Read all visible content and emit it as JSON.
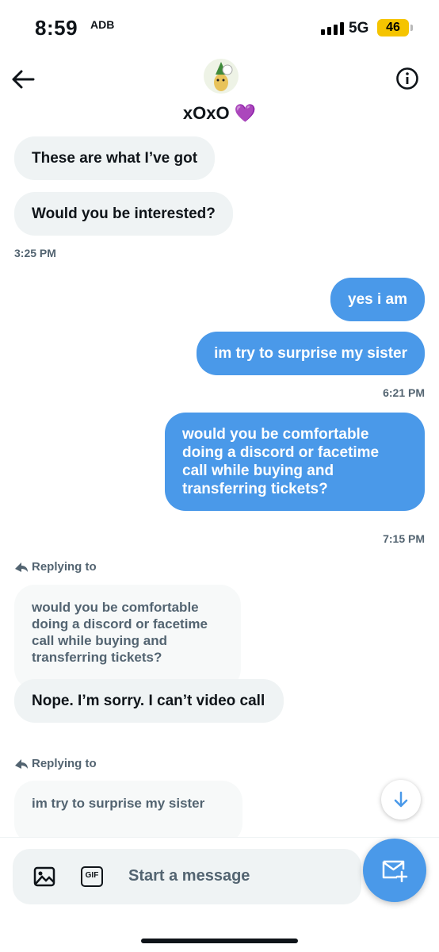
{
  "status_bar": {
    "time": "8:59",
    "extra": "ADB",
    "network": "5G",
    "battery": "46"
  },
  "header": {
    "name": "xOxO",
    "emoji": "💜"
  },
  "messages": {
    "r1": "These are what I’ve got",
    "r2": "Would you be interested?",
    "t1": "3:25 PM",
    "s1": "yes i am",
    "s2": "im try to surprise my sister",
    "t2": "6:21 PM",
    "s3": "would you be comfortable doing a discord or facetime call while buying and transferring tickets?",
    "t3": "7:15 PM",
    "reply1_label": "Replying to",
    "reply1_quote": "would you be comfortable doing a discord or facetime call while buying and transferring tickets?",
    "r3": "Nope. I’m sorry. I can’t video call",
    "reply2_label": "Replying to",
    "reply2_quote": "im try to surprise my sister"
  },
  "composer": {
    "placeholder": "Start a message",
    "gif_label": "GIF"
  },
  "colors": {
    "accent": "#4a99e9",
    "received_bg": "#eff3f4",
    "muted_text": "#536471"
  }
}
